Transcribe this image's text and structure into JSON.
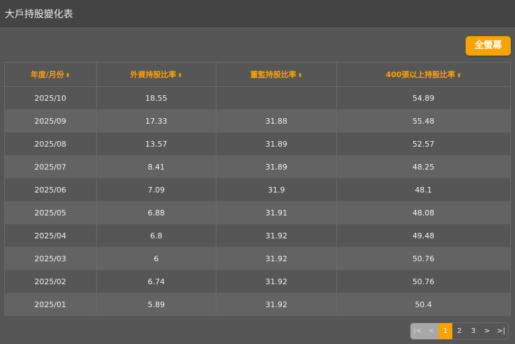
{
  "title": "大戶持股變化表",
  "fullscreen_label": "全螢幕",
  "columns": [
    "年度/月份",
    "外資持股比率",
    "董監持股比率",
    "400張以上持股比率"
  ],
  "sort_icon": "⬍",
  "rows": [
    [
      "2025/10",
      "18.55",
      "",
      "54.89"
    ],
    [
      "2025/09",
      "17.33",
      "31.88",
      "55.48"
    ],
    [
      "2025/08",
      "13.57",
      "31.89",
      "52.57"
    ],
    [
      "2025/07",
      "8.41",
      "31.89",
      "48.25"
    ],
    [
      "2025/06",
      "7.09",
      "31.9",
      "48.1"
    ],
    [
      "2025/05",
      "6.88",
      "31.91",
      "48.08"
    ],
    [
      "2025/04",
      "6.8",
      "31.92",
      "49.48"
    ],
    [
      "2025/03",
      "6",
      "31.92",
      "50.76"
    ],
    [
      "2025/02",
      "6.74",
      "31.92",
      "50.76"
    ],
    [
      "2025/01",
      "5.89",
      "31.92",
      "50.4"
    ]
  ],
  "pager": {
    "first": "|<",
    "prev": "<",
    "pages": [
      "1",
      "2",
      "3"
    ],
    "next": ">",
    "last": ">|",
    "current": "1"
  }
}
